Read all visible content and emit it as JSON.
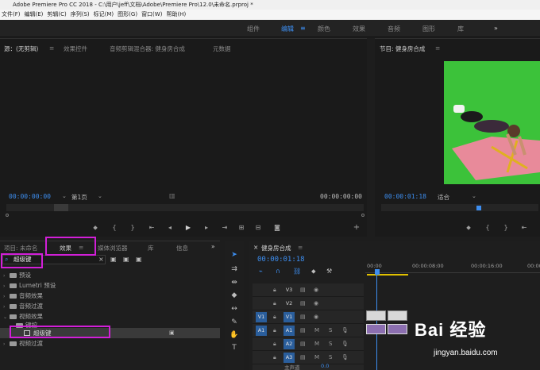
{
  "window": {
    "title": "Adobe Premiere Pro CC 2018 - C:\\用户\\jeff\\文档\\Adobe\\Premiere Pro\\12.0\\未命名.prproj *"
  },
  "menu": [
    "文件(F)",
    "编辑(E)",
    "剪辑(C)",
    "序列(S)",
    "标记(M)",
    "图形(G)",
    "窗口(W)",
    "帮助(H)"
  ],
  "workspace": {
    "tabs": [
      "组件",
      "编辑",
      "颜色",
      "效果",
      "音频",
      "图形",
      "库"
    ],
    "active": "编辑",
    "overflow": "»"
  },
  "source_monitor": {
    "tabs": [
      "源：(无剪辑)",
      "效果控件",
      "音频剪辑混合器: 健身房合成",
      "元数据"
    ],
    "timecode_left": "00:00:00:00",
    "page_select": "第1页",
    "timecode_right": "00:00:00:00"
  },
  "program_monitor": {
    "tab": "节目: 健身房合成",
    "timecode": "00:00:01:18",
    "fit": "适合"
  },
  "effects_panel": {
    "tabs": [
      "项目: 未命名",
      "效果",
      "媒体浏览器",
      "库",
      "信息"
    ],
    "search_value": "超级键",
    "tree": [
      {
        "label": "预设",
        "level": 0
      },
      {
        "label": "Lumetri 预设",
        "level": 0
      },
      {
        "label": "音频效果",
        "level": 0
      },
      {
        "label": "音频过渡",
        "level": 0
      },
      {
        "label": "视频效果",
        "level": 0
      },
      {
        "label": "键控",
        "level": 1
      },
      {
        "label": "超级键",
        "level": 2
      },
      {
        "label": "视频过渡",
        "level": 0
      }
    ]
  },
  "timeline": {
    "tab": "健身房合成",
    "timecode": "00:00:01:18",
    "ruler": [
      "00:00",
      "00:00:08:00",
      "00:00:16:00",
      "00:00"
    ],
    "tracks": [
      {
        "id": "V3",
        "type": "video"
      },
      {
        "id": "V2",
        "type": "video"
      },
      {
        "id": "V1",
        "type": "video"
      },
      {
        "id": "A1",
        "type": "audio"
      },
      {
        "id": "A2",
        "type": "audio"
      },
      {
        "id": "A3",
        "type": "audio"
      }
    ],
    "master": "主声道",
    "master_value": "0.0"
  },
  "watermark": {
    "brand": "Bai 经验",
    "url": "jingyan.baidu.com"
  },
  "colors": {
    "accent": "#3d8ef0",
    "highlight": "#d21fd8",
    "green_screen": "#3cc23a"
  }
}
